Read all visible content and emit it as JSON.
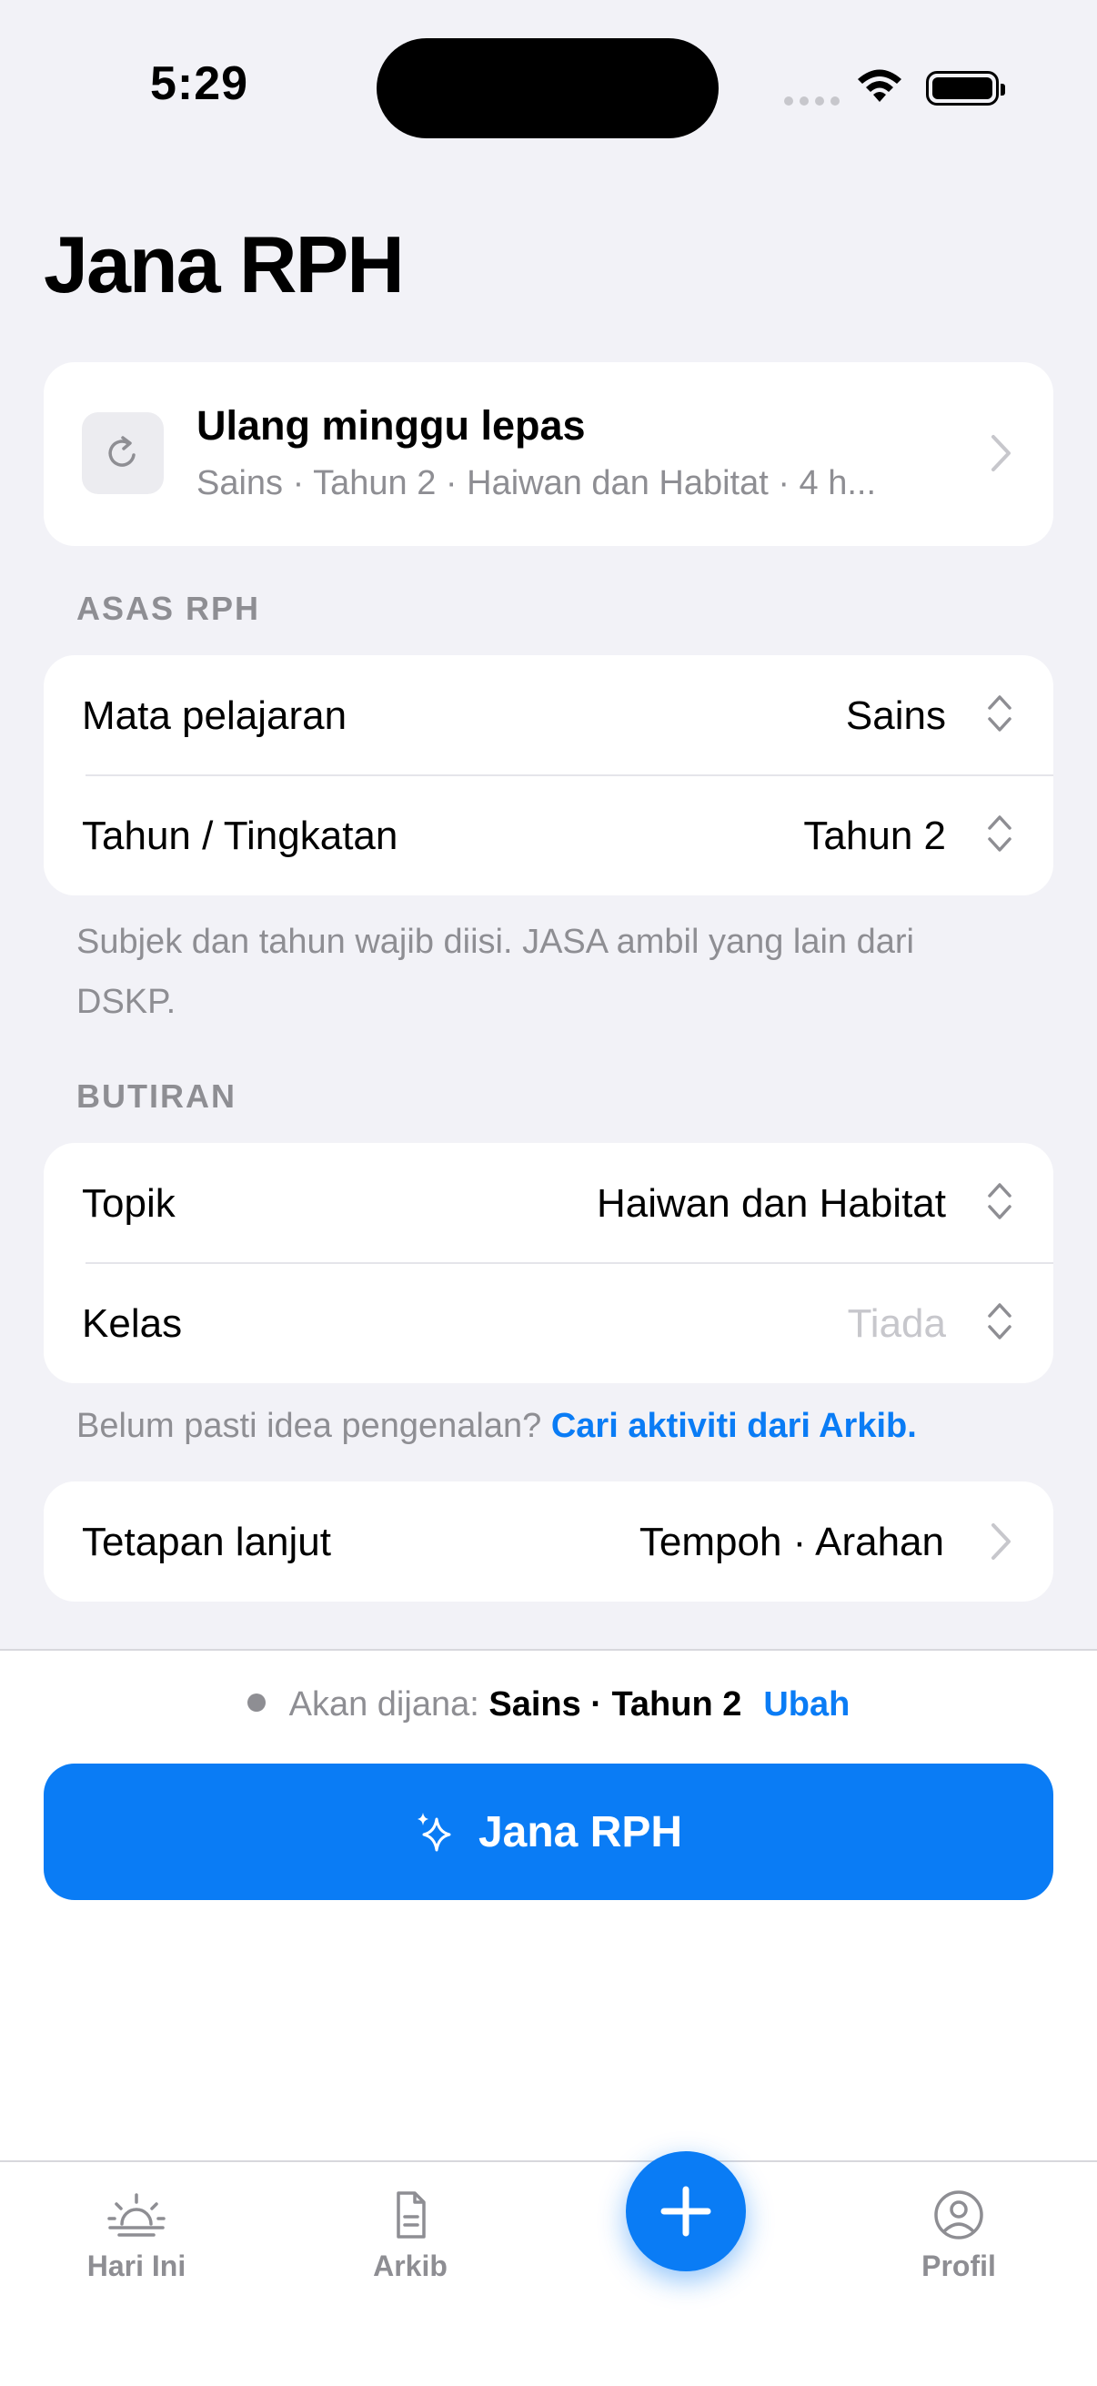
{
  "status_bar": {
    "time": "5:29"
  },
  "header": {
    "title": "Jana RPH"
  },
  "repeat_card": {
    "title": "Ulang minggu lepas",
    "subtitle": "Sains · Tahun 2 · Haiwan dan Habitat · 4 h...",
    "icon": "refresh-icon"
  },
  "asas_section": {
    "label": "ASAS RPH",
    "rows": [
      {
        "label": "Mata pelajaran",
        "value": "Sains"
      },
      {
        "label": "Tahun / Tingkatan",
        "value": "Tahun 2"
      }
    ],
    "footnote": "Subjek dan tahun wajib diisi. JASA ambil yang lain dari DSKP."
  },
  "butiran_section": {
    "label": "BUTIRAN",
    "rows": [
      {
        "label": "Topik",
        "value": "Haiwan dan Habitat"
      },
      {
        "label": "Kelas",
        "value": "Tiada"
      }
    ],
    "footnote_text": "Belum pasti idea pengenalan? ",
    "footnote_link": "Cari aktiviti dari Arkib."
  },
  "advanced": {
    "label": "Tetapan lanjut",
    "value": "Tempoh · Arahan"
  },
  "summary": {
    "prefix": "Akan dijana: ",
    "value": "Sains · Tahun 2",
    "edit": "Ubah"
  },
  "primary_button": {
    "label": "Jana RPH",
    "icon": "sparkles-icon"
  },
  "tabbar": {
    "tabs": [
      {
        "label": "Hari Ini",
        "icon": "sunrise-icon"
      },
      {
        "label": "Arkib",
        "icon": "document-icon"
      },
      {
        "label": "Profil",
        "icon": "person-circle-icon"
      }
    ],
    "fab_icon": "plus-icon"
  },
  "colors": {
    "accent": "#0a7cf5",
    "background": "#f2f2f7",
    "secondary_text": "#8e8e93"
  }
}
